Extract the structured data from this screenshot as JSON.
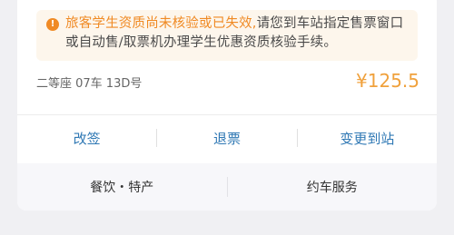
{
  "notice": {
    "icon": "alert-icon",
    "highlight": "旅客学生资质尚未核验或已失效,",
    "rest": "请您到车站指定售票窗口或自动售/取票机办理学生优惠资质核验手续。"
  },
  "ticket": {
    "seat_info": "二等座 07车 13D号",
    "price": "¥125.5"
  },
  "actions": {
    "change": "改签",
    "refund": "退票",
    "change_station": "变更到站"
  },
  "services": {
    "food": "餐饮・特产",
    "car": "约车服务"
  }
}
